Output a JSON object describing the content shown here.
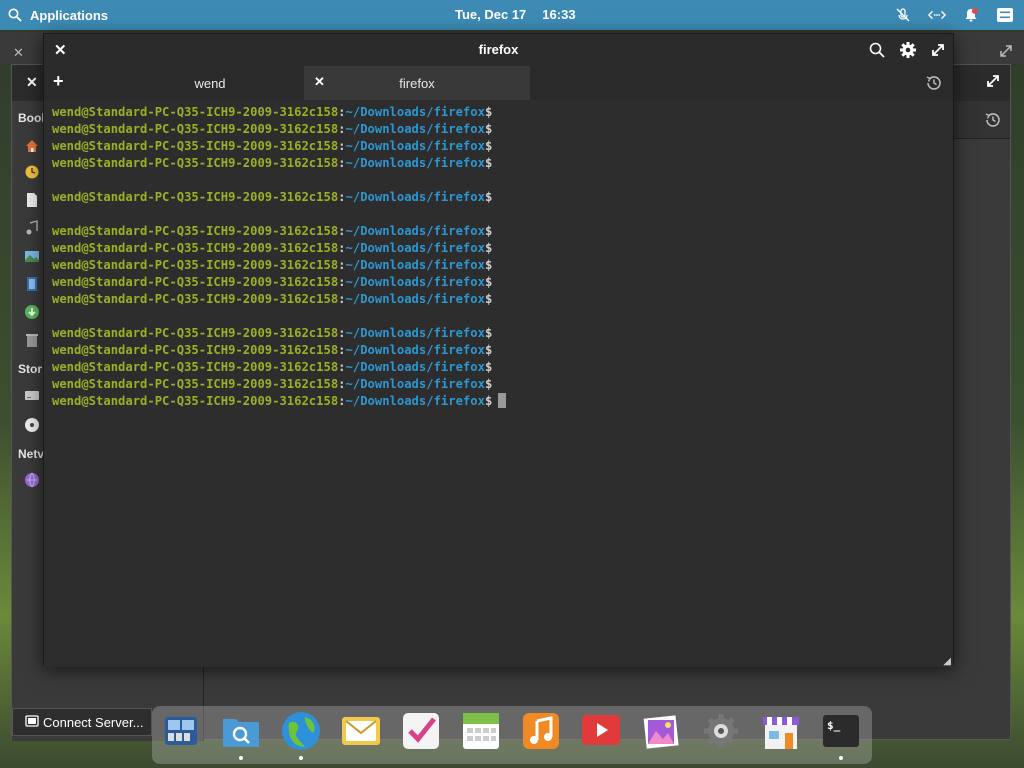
{
  "top_panel": {
    "applications_label": "Applications",
    "date": "Tue, Dec 17",
    "time": "16:33",
    "indicators": [
      "mic-muted-icon",
      "network-icon",
      "notification-icon",
      "power-icon"
    ]
  },
  "file_manager": {
    "sidebar_sections": [
      "Bookmarks",
      "Storage",
      "Network"
    ],
    "sidebar_sections_visible": [
      "Book",
      "Stor",
      "Netv"
    ],
    "status_button": "Connect Server..."
  },
  "terminal": {
    "title": "firefox",
    "tabs": [
      {
        "label": "wend",
        "active": false
      },
      {
        "label": "firefox",
        "active": true
      }
    ],
    "prompt": {
      "user_host": "wend@Standard-PC-Q35-ICH9-2009-3162c158",
      "separator": ":",
      "path": "~/Downloads/firefox",
      "symbol": "$"
    },
    "lines": [
      "prompt",
      "prompt",
      "prompt",
      "prompt",
      "blank",
      "prompt",
      "blank",
      "prompt",
      "prompt",
      "prompt",
      "prompt",
      "prompt",
      "blank",
      "prompt",
      "prompt",
      "prompt",
      "prompt",
      "prompt-cursor"
    ]
  },
  "dock": {
    "apps": [
      {
        "name": "multitasking-view-icon",
        "running": false,
        "color": "#3a6fb0"
      },
      {
        "name": "files-icon",
        "running": true,
        "color": "#4a9ad6"
      },
      {
        "name": "web-browser-icon",
        "running": true,
        "color": "#2f8fd8"
      },
      {
        "name": "mail-icon",
        "running": false,
        "color": "#f2c94c"
      },
      {
        "name": "tasks-icon",
        "running": false,
        "color": "#ffffff"
      },
      {
        "name": "calendar-icon",
        "running": false,
        "color": "#7cc04a"
      },
      {
        "name": "music-icon",
        "running": false,
        "color": "#f08a24"
      },
      {
        "name": "videos-icon",
        "running": false,
        "color": "#e03a3a"
      },
      {
        "name": "photos-icon",
        "running": false,
        "color": "#a25ad8"
      },
      {
        "name": "system-settings-icon",
        "running": false,
        "color": "#666666"
      },
      {
        "name": "appcenter-icon",
        "running": false,
        "color": "#8a5ad8"
      },
      {
        "name": "terminal-icon",
        "running": true,
        "color": "#2b2b2b"
      }
    ]
  }
}
